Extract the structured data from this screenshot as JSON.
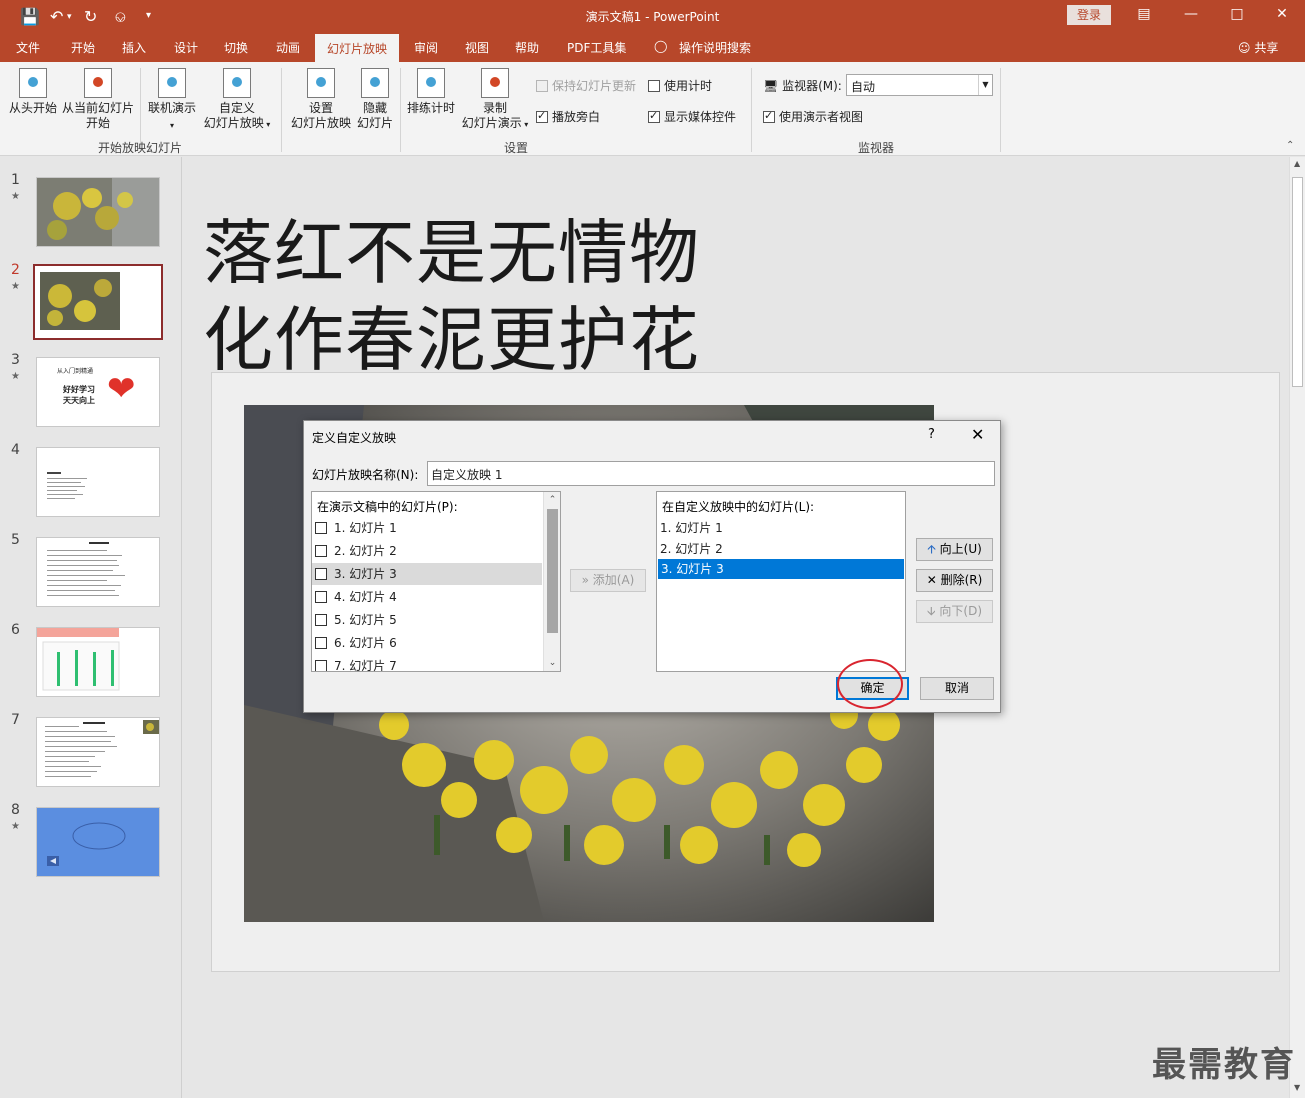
{
  "window": {
    "title": "演示文稿1  -  PowerPoint",
    "login": "登录",
    "accent": "#b7472a"
  },
  "tabs": {
    "items": [
      "文件",
      "开始",
      "插入",
      "设计",
      "切换",
      "动画",
      "幻灯片放映",
      "审阅",
      "视图",
      "帮助",
      "PDF工具集"
    ],
    "active": "幻灯片放映",
    "search": "操作说明搜索",
    "share": "共享"
  },
  "ribbon": {
    "from_beginning": "从头开始",
    "from_current_1": "从当前幻灯片",
    "from_current_2": "开始",
    "online_present": "联机演示",
    "custom_show_1": "自定义",
    "custom_show_2": "幻灯片放映",
    "group_start": "开始放映幻灯片",
    "setup_1": "设置",
    "setup_2": "幻灯片放映",
    "hide_1": "隐藏",
    "hide_2": "幻灯片",
    "rehearse": "排练计时",
    "record_1": "录制",
    "record_2": "幻灯片演示",
    "keep_updated": "保持幻灯片更新",
    "use_timings": "使用计时",
    "play_narration": "播放旁白",
    "show_media": "显示媒体控件",
    "group_setup": "设置",
    "monitor_label": "监视器(M):",
    "monitor_value": "自动",
    "presenter_view": "使用演示者视图",
    "group_monitor": "监视器"
  },
  "thumbnails": {
    "slides": [
      {
        "num": "1",
        "star": "★"
      },
      {
        "num": "2",
        "star": "★"
      },
      {
        "num": "3",
        "star": "★"
      },
      {
        "num": "4",
        "star": ""
      },
      {
        "num": "5",
        "star": ""
      },
      {
        "num": "6",
        "star": ""
      },
      {
        "num": "7",
        "star": ""
      },
      {
        "num": "8",
        "star": "★"
      }
    ],
    "slide3_line1": "从入门到精通",
    "slide3_line2": "好好学习",
    "slide3_line3": "天天向上"
  },
  "slide": {
    "title_line1": "落红不是无情物",
    "title_line2": "化作春泥更护花"
  },
  "dialog": {
    "title": "定义自定义放映",
    "help": "?",
    "name_label": "幻灯片放映名称(N):",
    "name_value": "自定义放映 1",
    "left_list_label": "在演示文稿中的幻灯片(P):",
    "left_items": [
      "1. 幻灯片 1",
      "2. 幻灯片 2",
      "3. 幻灯片 3",
      "4. 幻灯片 4",
      "5. 幻灯片 5",
      "6. 幻灯片 6",
      "7. 幻灯片 7"
    ],
    "add_button": "添加(A)",
    "right_list_label": "在自定义放映中的幻灯片(L):",
    "right_items": [
      "1. 幻灯片 1",
      "2. 幻灯片 2",
      "3. 幻灯片 3"
    ],
    "up_button": "向上(U)",
    "delete_button": "删除(R)",
    "down_button": "向下(D)",
    "ok_button": "确定",
    "cancel_button": "取消"
  },
  "watermark": "最需教育"
}
